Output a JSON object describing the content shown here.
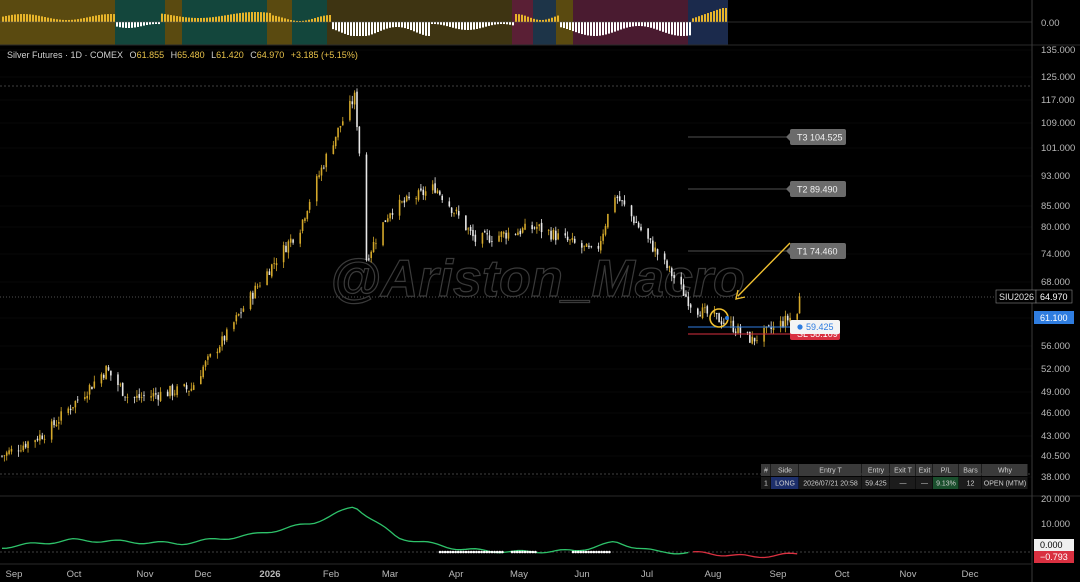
{
  "header": {
    "instrument": "Silver Futures · 1D · COMEX",
    "open_label": "O",
    "open": "61.855",
    "high_label": "H",
    "high": "65.480",
    "low_label": "L",
    "low": "61.420",
    "close_label": "C",
    "close": "64.970",
    "change": "+3.185 (+5.15%)"
  },
  "watermark": "@Ariston_Macro",
  "top_panel": {
    "zero_label": "0.00"
  },
  "bottom_panel": {
    "label_20": "20.000",
    "label_10": "10.000",
    "zero_label": "0.000",
    "value_label": "−0.793"
  },
  "price_tags": {
    "symbol": "SIU2026",
    "last": "64.970",
    "level": "61.100",
    "entry": "59.425",
    "entry_icon": "target-dot-icon",
    "stop_partial": "SL 58.109"
  },
  "targets": [
    {
      "label": "T3 104.525",
      "value": 104.525
    },
    {
      "label": "T2 89.490",
      "value": 89.49
    },
    {
      "label": "T1 74.460",
      "value": 74.46
    }
  ],
  "trade_table": {
    "headers": [
      "#",
      "Side",
      "Entry T",
      "Entry",
      "Exit T",
      "Exit",
      "P/L",
      "Bars",
      "Why"
    ],
    "row": [
      "1",
      "LONG",
      "2026/07/21 20:58",
      "59.425",
      "—",
      "—",
      "9.13%",
      "12",
      "OPEN (MTM)"
    ]
  },
  "colors": {
    "bull": "#d4a82a",
    "bear": "#e8e8e8",
    "target_box": "#6b6b6b",
    "entry_blue": "#2f7de0",
    "stop_red": "#d93040",
    "osc_green": "#2ec26a",
    "osc_red": "#d93040",
    "arrow": "#f0c030"
  },
  "chart_data": {
    "type": "candlestick",
    "y_ticks": [
      135,
      125,
      117,
      109,
      101,
      93,
      85,
      80,
      74,
      68,
      61,
      56,
      52,
      49,
      46,
      43,
      40.5,
      38
    ],
    "y_tick_labels": [
      "135.000",
      "125.000",
      "117.000",
      "109.000",
      "101.000",
      "93.000",
      "85.000",
      "80.000",
      "74.000",
      "68.000",
      "",
      "56.000",
      "52.000",
      "49.000",
      "46.000",
      "43.000",
      "40.500",
      "38.000"
    ],
    "x_labels": [
      "Sep",
      "Oct",
      "Nov",
      "Dec",
      "2026",
      "Feb",
      "Mar",
      "Apr",
      "May",
      "Jun",
      "Jul",
      "Aug",
      "Sep",
      "Oct",
      "Nov",
      "Dec"
    ],
    "ylim": [
      36,
      140
    ],
    "series_keypoints": [
      {
        "date": "2025-09-01",
        "close": 40.5
      },
      {
        "date": "2025-09-20",
        "close": 43.5
      },
      {
        "date": "2025-10-15",
        "close": 52
      },
      {
        "date": "2025-10-25",
        "close": 48
      },
      {
        "date": "2025-11-20",
        "close": 49.5
      },
      {
        "date": "2025-12-05",
        "close": 58
      },
      {
        "date": "2026-01-05",
        "close": 80
      },
      {
        "date": "2026-01-20",
        "close": 105
      },
      {
        "date": "2026-01-28",
        "close": 118
      },
      {
        "date": "2026-02-02",
        "close": 73
      },
      {
        "date": "2026-02-12",
        "close": 84
      },
      {
        "date": "2026-03-03",
        "close": 90
      },
      {
        "date": "2026-03-20",
        "close": 77
      },
      {
        "date": "2026-04-15",
        "close": 80
      },
      {
        "date": "2026-05-10",
        "close": 74
      },
      {
        "date": "2026-05-18",
        "close": 88
      },
      {
        "date": "2026-06-01",
        "close": 77
      },
      {
        "date": "2026-06-20",
        "close": 63
      },
      {
        "date": "2026-07-05",
        "close": 60
      },
      {
        "date": "2026-07-15",
        "close": 57
      },
      {
        "date": "2026-07-25",
        "close": 59.5
      },
      {
        "date": "2026-08-03",
        "close": 61.8
      },
      {
        "date": "2026-08-04",
        "close": 64.97
      }
    ],
    "oscillator": {
      "ylim": [
        -2,
        21
      ],
      "keypoints": [
        {
          "date": "2025-09-01",
          "value": 2
        },
        {
          "date": "2025-10-01",
          "value": 5
        },
        {
          "date": "2025-11-15",
          "value": 3.5
        },
        {
          "date": "2025-12-15",
          "value": 7
        },
        {
          "date": "2026-01-10",
          "value": 12
        },
        {
          "date": "2026-01-28",
          "value": 19
        },
        {
          "date": "2026-02-15",
          "value": 6
        },
        {
          "date": "2026-03-15",
          "value": 1
        },
        {
          "date": "2026-04-05",
          "value": 0
        },
        {
          "date": "2026-05-01",
          "value": 0.5
        },
        {
          "date": "2026-05-18",
          "value": 4
        },
        {
          "date": "2026-06-05",
          "value": 0
        },
        {
          "date": "2026-06-25",
          "value": -0.5
        },
        {
          "date": "2026-07-15",
          "value": -2
        },
        {
          "date": "2026-08-04",
          "value": -0.793
        }
      ]
    }
  }
}
